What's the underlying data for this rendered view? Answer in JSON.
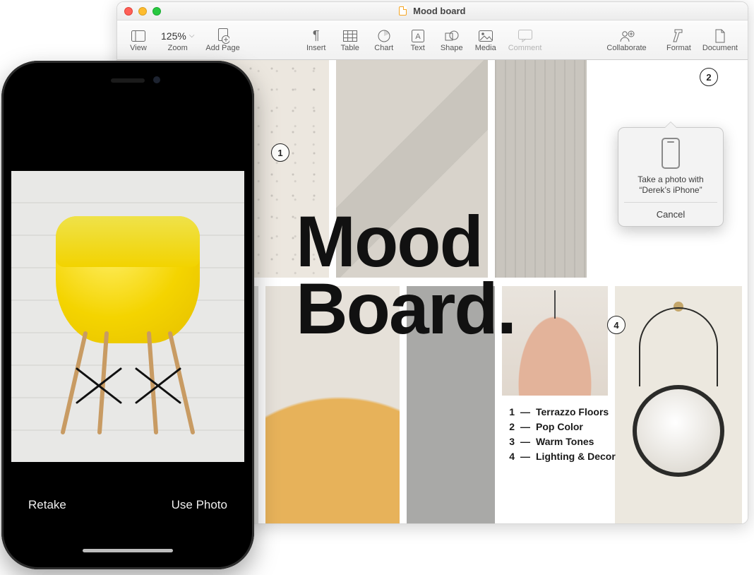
{
  "window": {
    "title": "Mood board"
  },
  "toolbar": {
    "view": "View",
    "zoom_value": "125%",
    "zoom_label": "Zoom",
    "add_page": "Add Page",
    "insert": "Insert",
    "table": "Table",
    "chart": "Chart",
    "text": "Text",
    "shape": "Shape",
    "media": "Media",
    "comment": "Comment",
    "collaborate": "Collaborate",
    "format": "Format",
    "document": "Document"
  },
  "doc": {
    "title_line1": "Mood",
    "title_line2": "Board.",
    "legend": [
      {
        "n": "1",
        "label": "Terrazzo Floors"
      },
      {
        "n": "2",
        "label": "Pop Color"
      },
      {
        "n": "3",
        "label": "Warm Tones"
      },
      {
        "n": "4",
        "label": "Lighting & Decor"
      }
    ],
    "markers": {
      "m1": "1",
      "m2": "2",
      "m4": "4"
    }
  },
  "popover": {
    "line1": "Take a photo with",
    "line2": "“Derek’s iPhone”",
    "cancel": "Cancel"
  },
  "iphone": {
    "retake": "Retake",
    "use_photo": "Use Photo"
  }
}
